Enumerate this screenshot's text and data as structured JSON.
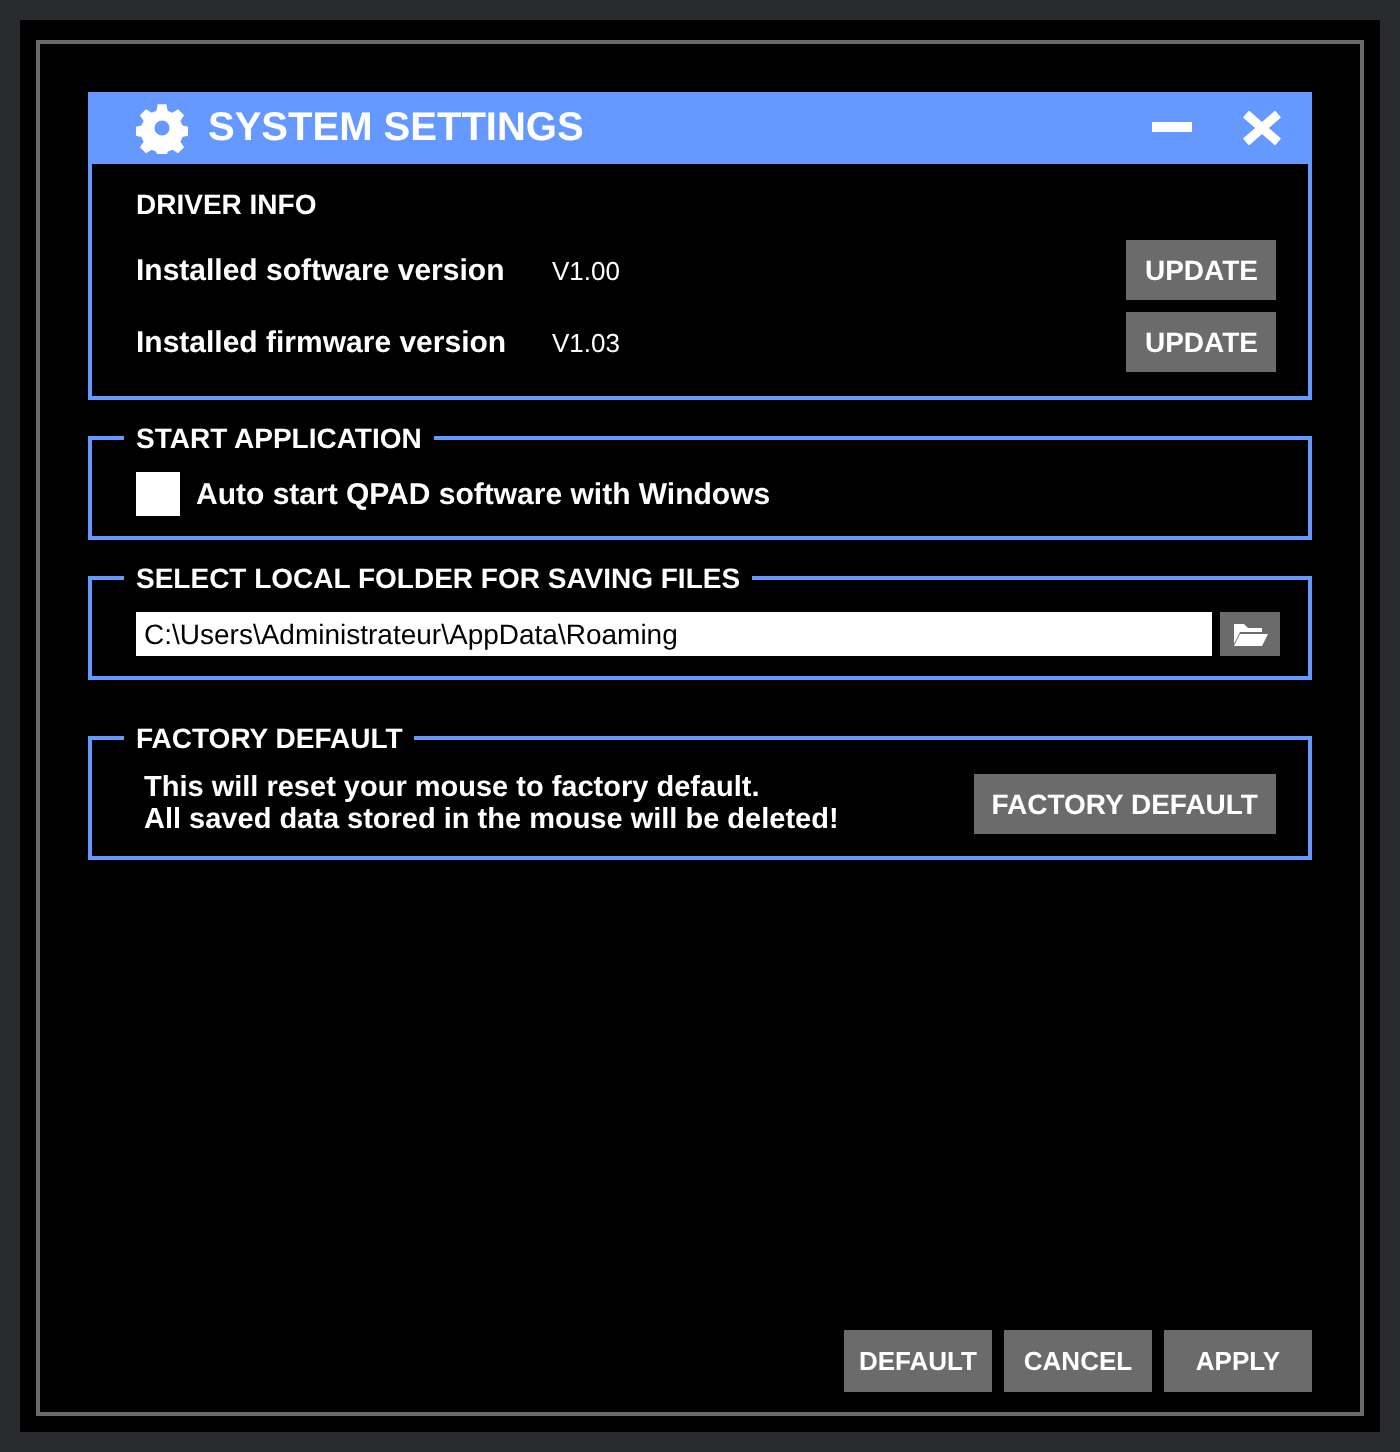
{
  "window": {
    "title": "SYSTEM SETTINGS"
  },
  "driver_info": {
    "heading": "DRIVER INFO",
    "rows": [
      {
        "label": "Installed software version",
        "value": "V1.00",
        "button": "UPDATE"
      },
      {
        "label": "Installed firmware version",
        "value": "V1.03",
        "button": "UPDATE"
      }
    ]
  },
  "start_application": {
    "heading": "START APPLICATION",
    "checkbox": {
      "label": "Auto start QPAD software with Windows",
      "checked": false
    }
  },
  "local_folder": {
    "heading": "SELECT LOCAL FOLDER FOR SAVING FILES",
    "path": "C:\\Users\\Administrateur\\AppData\\Roaming"
  },
  "factory_default": {
    "heading": "FACTORY DEFAULT",
    "message_lines": [
      "This will reset your mouse to factory default.",
      "All saved data stored in the mouse will be deleted!"
    ],
    "button": "FACTORY DEFAULT"
  },
  "footer_buttons": [
    "DEFAULT",
    "CANCEL",
    "APPLY"
  ]
}
